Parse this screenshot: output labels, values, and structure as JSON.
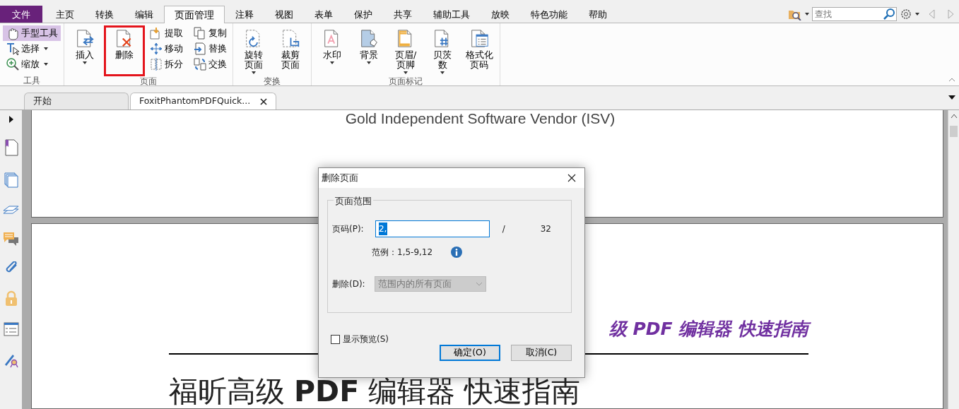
{
  "menu_tabs": [
    {
      "label": "文件",
      "kind": "file",
      "selected": false
    },
    {
      "label": "主页",
      "kind": "tab",
      "selected": false
    },
    {
      "label": "转换",
      "kind": "tab",
      "selected": false
    },
    {
      "label": "编辑",
      "kind": "tab",
      "selected": false
    },
    {
      "label": "页面管理",
      "kind": "tab",
      "selected": true
    },
    {
      "label": "注释",
      "kind": "tab",
      "selected": false
    },
    {
      "label": "视图",
      "kind": "tab",
      "selected": false
    },
    {
      "label": "表单",
      "kind": "tab",
      "selected": false
    },
    {
      "label": "保护",
      "kind": "tab",
      "selected": false
    },
    {
      "label": "共享",
      "kind": "tab",
      "selected": false
    },
    {
      "label": "辅助工具",
      "kind": "tab",
      "selected": false
    },
    {
      "label": "放映",
      "kind": "tab",
      "selected": false
    },
    {
      "label": "特色功能",
      "kind": "tab",
      "selected": false
    },
    {
      "label": "帮助",
      "kind": "tab",
      "selected": false
    }
  ],
  "search": {
    "placeholder": "查找"
  },
  "ribbon": [
    {
      "title": "工具",
      "items": [
        {
          "label": "手型工具",
          "kind": "small",
          "selected": true,
          "dropdown": false
        },
        {
          "label": "选择",
          "kind": "small",
          "selected": false,
          "dropdown": true
        },
        {
          "label": "缩放",
          "kind": "small",
          "selected": false,
          "dropdown": true
        }
      ]
    },
    {
      "title": "页面",
      "items": [
        {
          "label": "插入",
          "kind": "large",
          "dropdown": true,
          "highlighted": false
        },
        {
          "label": "删除",
          "kind": "large",
          "dropdown": false,
          "highlighted": true
        },
        {
          "label": "提取",
          "kind": "small",
          "selected": false,
          "dropdown": false
        },
        {
          "label": "移动",
          "kind": "small",
          "selected": false,
          "dropdown": false
        },
        {
          "label": "拆分",
          "kind": "small",
          "selected": false,
          "dropdown": false
        },
        {
          "label": "复制",
          "kind": "small",
          "selected": false,
          "dropdown": false
        },
        {
          "label": "替换",
          "kind": "small",
          "selected": false,
          "dropdown": false
        },
        {
          "label": "交换",
          "kind": "small",
          "selected": false,
          "dropdown": false
        }
      ]
    },
    {
      "title": "变换",
      "items": [
        {
          "label": "旋转页面",
          "kind": "large",
          "dropdown": true,
          "highlighted": false
        },
        {
          "label": "裁剪页面",
          "kind": "large",
          "dropdown": false,
          "highlighted": false
        }
      ]
    },
    {
      "title": "页面标记",
      "items": [
        {
          "label": "水印",
          "kind": "large",
          "dropdown": true,
          "highlighted": false
        },
        {
          "label": "背景",
          "kind": "large",
          "dropdown": true,
          "highlighted": false
        },
        {
          "label": "页眉/页脚",
          "kind": "large",
          "dropdown": true,
          "highlighted": false
        },
        {
          "label": "贝茨数",
          "kind": "large",
          "dropdown": true,
          "highlighted": false
        },
        {
          "label": "格式化页码",
          "kind": "large",
          "dropdown": false,
          "highlighted": false
        }
      ]
    }
  ],
  "doc_tabs": [
    {
      "label": "开始",
      "selected": false,
      "closable": false
    },
    {
      "label": "FoxitPhantomPDFQuick...",
      "selected": true,
      "closable": true
    }
  ],
  "pages": [
    {
      "kind": "cover_end",
      "texts": [
        "Gold Independent Software Vendor (ISV)"
      ]
    },
    {
      "kind": "title_page",
      "subtitle": "级 PDF 编辑器  快速指南",
      "heading": "福昕高级 **PDF** 编辑器  快速指南"
    }
  ],
  "dialog": {
    "title": "删除页面",
    "group_title": "页面范围",
    "page_label": "页码(P):",
    "page_value": "2,",
    "separator": "/",
    "page_count": "32",
    "example": "范例：1,5-9,12",
    "delete_label": "删除(D):",
    "delete_value": "范围内的所有页面",
    "delete_disabled": true,
    "preview": {
      "label": "显示预览(S)",
      "checked": false
    },
    "buttons": [
      {
        "label": "确定(O)",
        "default": true
      },
      {
        "label": "取消(C)",
        "default": false
      }
    ]
  }
}
